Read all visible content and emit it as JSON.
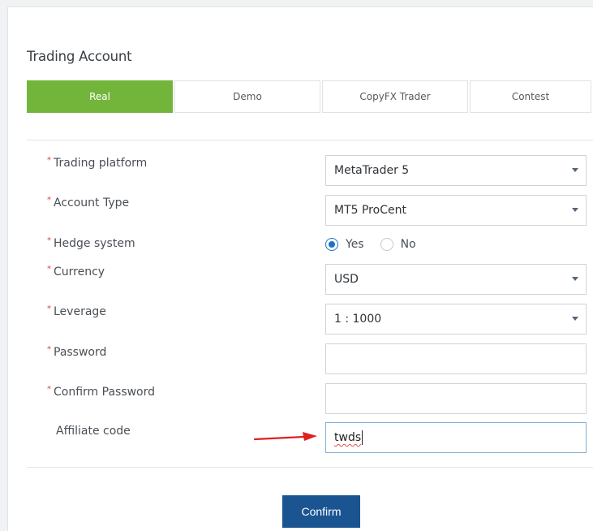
{
  "title": "Trading Account",
  "tabs": [
    {
      "label": "Real",
      "active": true
    },
    {
      "label": "Demo",
      "active": false
    },
    {
      "label": "CopyFX Trader",
      "active": false
    },
    {
      "label": "Contest",
      "active": false
    }
  ],
  "required_marker": "*",
  "form": {
    "platform": {
      "label": "Trading platform",
      "value": "MetaTrader 5"
    },
    "account_type": {
      "label": "Account Type",
      "value": "MT5 ProCent"
    },
    "hedge": {
      "label": "Hedge system",
      "options": [
        "Yes",
        "No"
      ],
      "selected": "Yes"
    },
    "currency": {
      "label": "Currency",
      "value": "USD"
    },
    "leverage": {
      "label": "Leverage",
      "value": "1 : 1000"
    },
    "password": {
      "label": "Password",
      "value": ""
    },
    "confirm_password": {
      "label": "Confirm Password",
      "value": ""
    },
    "affiliate": {
      "label": "Affiliate code",
      "value": "twds"
    }
  },
  "confirm_label": "Confirm",
  "colors": {
    "active_tab": "#73b53b",
    "confirm_button": "#1a5591",
    "radio_checked": "#1a73c7",
    "required": "#e03a3a",
    "annotation_arrow": "#e02020"
  },
  "icons": {
    "dropdown": "chevron-down-icon",
    "annotation": "red-arrow-icon"
  }
}
